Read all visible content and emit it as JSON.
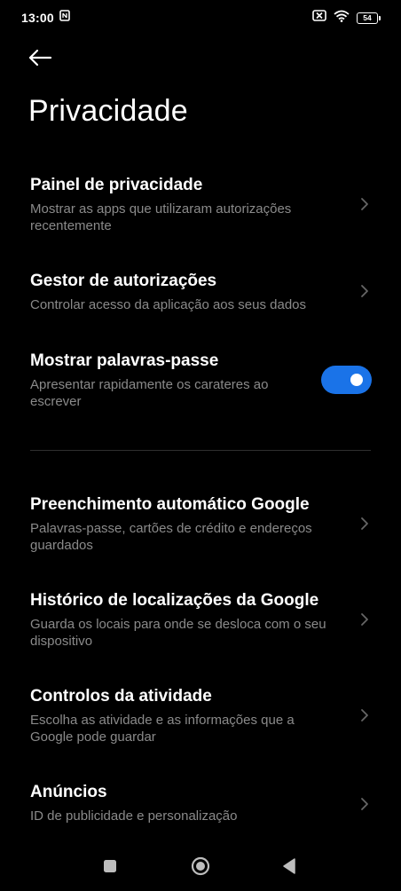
{
  "status_bar": {
    "time": "13:00",
    "battery_level": "54",
    "icons": [
      "nfc-icon",
      "no-sim-icon",
      "wifi-icon",
      "battery-icon"
    ]
  },
  "header": {
    "back_icon": "back-arrow-icon",
    "title": "Privacidade"
  },
  "items": [
    {
      "title": "Painel de privacidade",
      "description": "Mostrar as apps que utilizaram autorizações recentemente",
      "control": "chevron-right-icon"
    },
    {
      "title": "Gestor de autorizações",
      "description": "Controlar acesso da aplicação aos seus dados",
      "control": "chevron-right-icon"
    },
    {
      "title": "Mostrar palavras-passe",
      "description": "Apresentar rapidamente os carateres ao escrever",
      "control": "toggle",
      "toggle_on": true
    },
    {
      "title": "Preenchimento automático Google",
      "description": "Palavras-passe, cartões de crédito e endereços guardados",
      "control": "chevron-right-icon"
    },
    {
      "title": "Histórico de localizações da Google",
      "description": "Guarda os locais para onde se desloca com o seu dispositivo",
      "control": "chevron-right-icon"
    },
    {
      "title": "Controlos da atividade",
      "description": "Escolha as atividade e as informações que a Google pode guardar",
      "control": "chevron-right-icon"
    },
    {
      "title": "Anúncios",
      "description": "ID de publicidade e personalização",
      "control": "chevron-right-icon"
    }
  ],
  "nav_bar": {
    "icons": [
      "recents-square-icon",
      "home-circle-icon",
      "back-triangle-icon"
    ]
  },
  "colors": {
    "background": "#000000",
    "text_primary": "#ffffff",
    "text_secondary": "#8a8a8a",
    "accent": "#1a73e8",
    "divider": "#2e2e2e"
  }
}
